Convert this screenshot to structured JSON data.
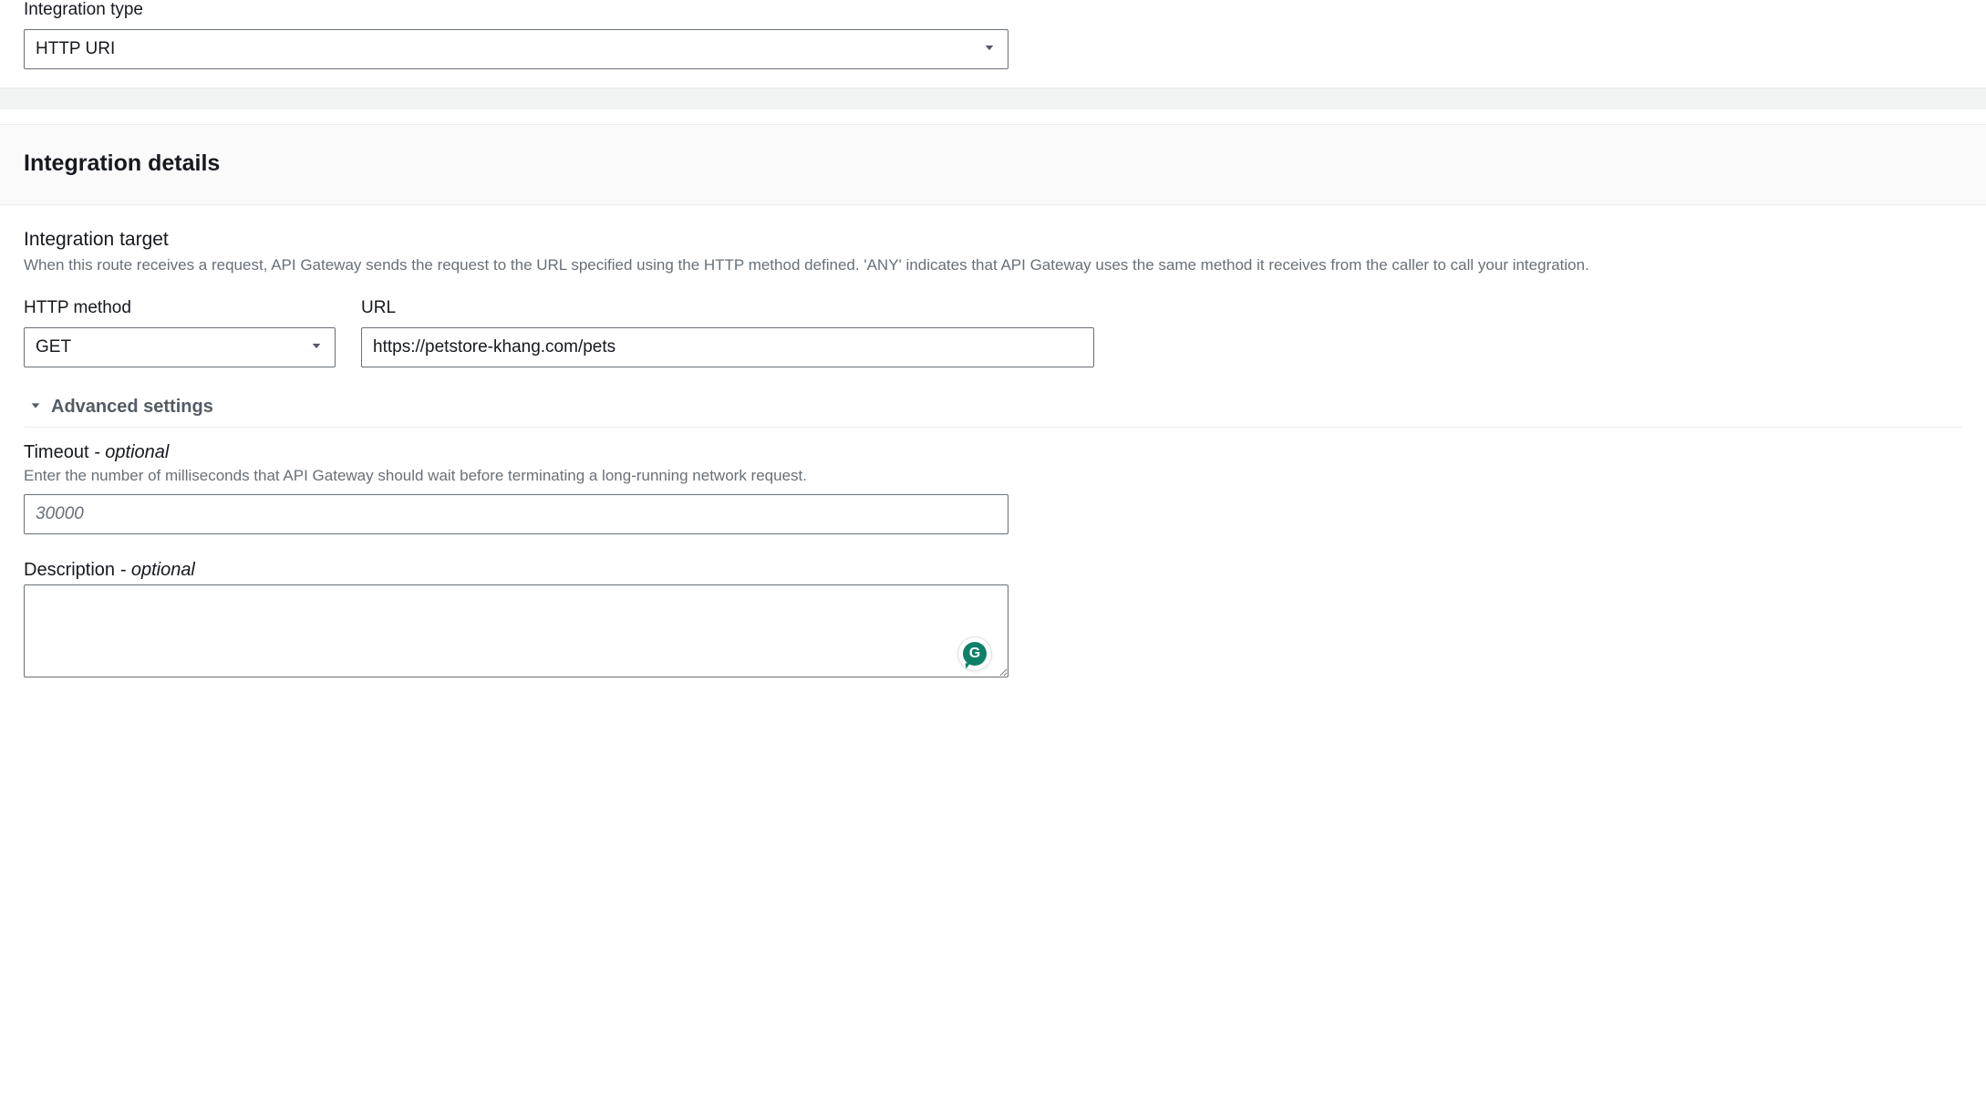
{
  "integrationType": {
    "label": "Integration type",
    "value": "HTTP URI"
  },
  "panel": {
    "title": "Integration details"
  },
  "target": {
    "label": "Integration target",
    "help": "When this route receives a request, API Gateway sends the request to the URL specified using the HTTP method defined. 'ANY' indicates that API Gateway uses the same method it receives from the caller to call your integration."
  },
  "method": {
    "label": "HTTP method",
    "value": "GET"
  },
  "url": {
    "label": "URL",
    "value": "https://petstore-khang.com/pets"
  },
  "advanced": {
    "title": "Advanced settings"
  },
  "timeout": {
    "label": "Timeout",
    "optional": " - optional",
    "help": "Enter the number of milliseconds that API Gateway should wait before terminating a long-running network request.",
    "placeholder": "30000",
    "value": ""
  },
  "description": {
    "label": "Description",
    "optional": " - optional",
    "value": ""
  }
}
